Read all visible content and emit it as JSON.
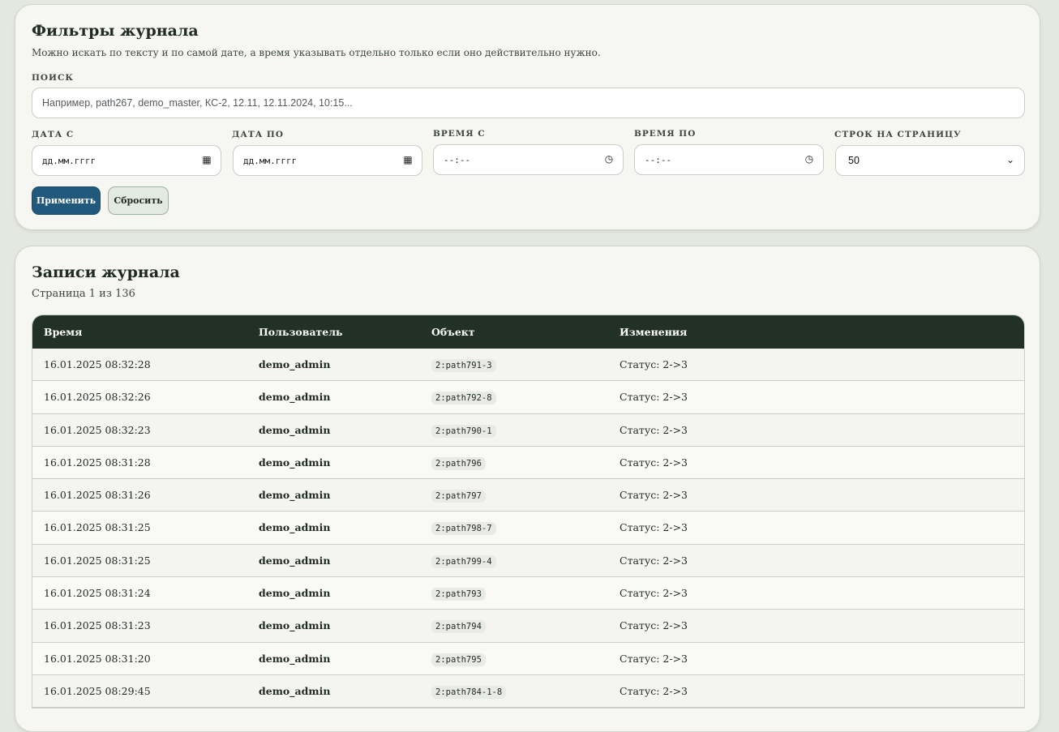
{
  "filters": {
    "title": "Фильтры журнала",
    "subtitle": "Можно искать по тексту и по самой дате, а время указывать отдельно только если оно действительно нужно.",
    "search": {
      "label": "Поиск",
      "placeholder": "Например, path267, demo_master, КС-2, 12.11, 12.11.2024, 10:15..."
    },
    "date_from": {
      "label": "Дата с",
      "value": "дд.мм.гггг"
    },
    "date_to": {
      "label": "Дата по",
      "value": "дд.мм.гггг"
    },
    "time_from": {
      "label": "Время с",
      "value": "--:--"
    },
    "time_to": {
      "label": "Время по",
      "value": "--:--"
    },
    "rows_per_page": {
      "label": "Строк на страницу",
      "value": "50"
    },
    "apply_label": "Применить",
    "reset_label": "Сбросить"
  },
  "records": {
    "title": "Записи журнала",
    "page_info": "Страница 1 из 136",
    "columns": [
      "Время",
      "Пользователь",
      "Объект",
      "Изменения"
    ],
    "rows": [
      {
        "time": "16.01.2025 08:32:28",
        "user": "demo_admin",
        "object": "2:path791-3",
        "change": "Статус: 2->3"
      },
      {
        "time": "16.01.2025 08:32:26",
        "user": "demo_admin",
        "object": "2:path792-8",
        "change": "Статус: 2->3"
      },
      {
        "time": "16.01.2025 08:32:23",
        "user": "demo_admin",
        "object": "2:path790-1",
        "change": "Статус: 2->3"
      },
      {
        "time": "16.01.2025 08:31:28",
        "user": "demo_admin",
        "object": "2:path796",
        "change": "Статус: 2->3"
      },
      {
        "time": "16.01.2025 08:31:26",
        "user": "demo_admin",
        "object": "2:path797",
        "change": "Статус: 2->3"
      },
      {
        "time": "16.01.2025 08:31:25",
        "user": "demo_admin",
        "object": "2:path798-7",
        "change": "Статус: 2->3"
      },
      {
        "time": "16.01.2025 08:31:25",
        "user": "demo_admin",
        "object": "2:path799-4",
        "change": "Статус: 2->3"
      },
      {
        "time": "16.01.2025 08:31:24",
        "user": "demo_admin",
        "object": "2:path793",
        "change": "Статус: 2->3"
      },
      {
        "time": "16.01.2025 08:31:23",
        "user": "demo_admin",
        "object": "2:path794",
        "change": "Статус: 2->3"
      },
      {
        "time": "16.01.2025 08:31:20",
        "user": "demo_admin",
        "object": "2:path795",
        "change": "Статус: 2->3"
      },
      {
        "time": "16.01.2025 08:29:45",
        "user": "demo_admin",
        "object": "2:path784-1-8",
        "change": "Статус: 2->3"
      }
    ]
  }
}
